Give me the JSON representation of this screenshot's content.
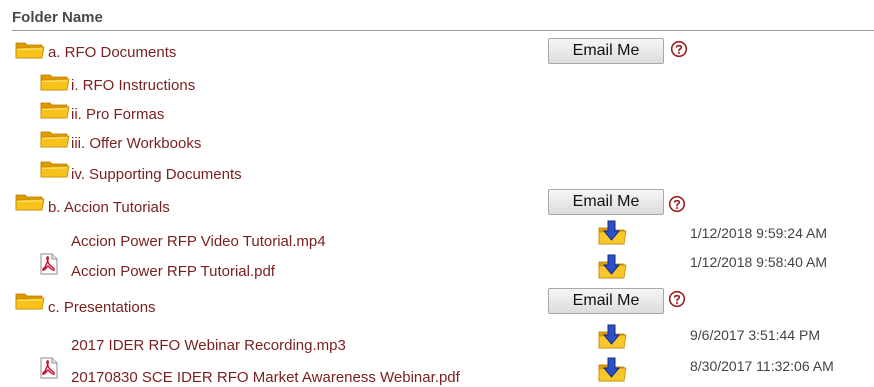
{
  "header": {
    "folder_name_label": "Folder Name"
  },
  "folders": [
    {
      "name": "a. RFO Documents",
      "email_label": "Email Me"
    },
    {
      "name": "b. Accion Tutorials",
      "email_label": "Email Me"
    },
    {
      "name": "c. Presentations",
      "email_label": "Email Me"
    }
  ],
  "subfolders": [
    {
      "name": "i. RFO Instructions"
    },
    {
      "name": "ii. Pro Formas"
    },
    {
      "name": "iii. Offer Workbooks"
    },
    {
      "name": "iv. Supporting Documents"
    }
  ],
  "files": [
    {
      "name": "Accion Power RFP Video Tutorial.mp4",
      "date": "1/12/2018 9:59:24 AM",
      "icon": "none"
    },
    {
      "name": "Accion Power RFP Tutorial.pdf",
      "date": "1/12/2018 9:58:40 AM",
      "icon": "pdf-icon"
    },
    {
      "name": "2017 IDER RFO Webinar Recording.mp3",
      "date": "9/6/2017 3:51:44 PM",
      "icon": "none"
    },
    {
      "name": "20170830 SCE IDER RFO Market Awareness Webinar.pdf",
      "date": "8/30/2017 11:32:06 AM",
      "icon": "pdf-icon"
    }
  ],
  "colors": {
    "link": "#7a1f1f",
    "folder": "#f5b400",
    "help": "#9b2020",
    "download": "#2b50c8"
  }
}
